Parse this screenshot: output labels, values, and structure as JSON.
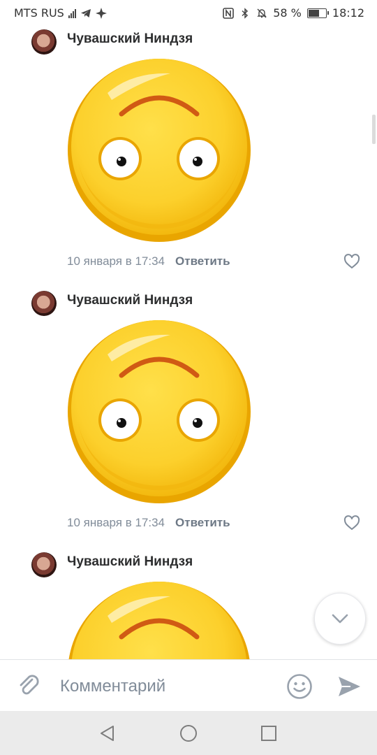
{
  "status_bar": {
    "carrier": "MTS RUS",
    "battery": "58 %",
    "time": "18:12",
    "icons": [
      "signal-icon",
      "telegram-icon",
      "sparkle-icon",
      "nfc-icon",
      "bluetooth-icon",
      "mute-icon",
      "battery-icon"
    ]
  },
  "comments": [
    {
      "author": "Чувашский Ниндзя",
      "date": "10 января в 17:34",
      "reply_label": "Ответить",
      "sticker": "upside-down-face-sticker"
    },
    {
      "author": "Чувашский Ниндзя",
      "date": "10 января в 17:34",
      "reply_label": "Ответить",
      "sticker": "upside-down-face-sticker"
    },
    {
      "author": "Чувашский Ниндзя",
      "sticker": "upside-down-face-sticker"
    }
  ],
  "composer": {
    "placeholder": "Комментарий",
    "value": ""
  },
  "colors": {
    "sticker_yellow": "#fdd02f",
    "sticker_rim": "#e9a500",
    "brow": "#d05a14",
    "meta_gray": "#818c99",
    "accent_gray": "#99a2ad"
  }
}
